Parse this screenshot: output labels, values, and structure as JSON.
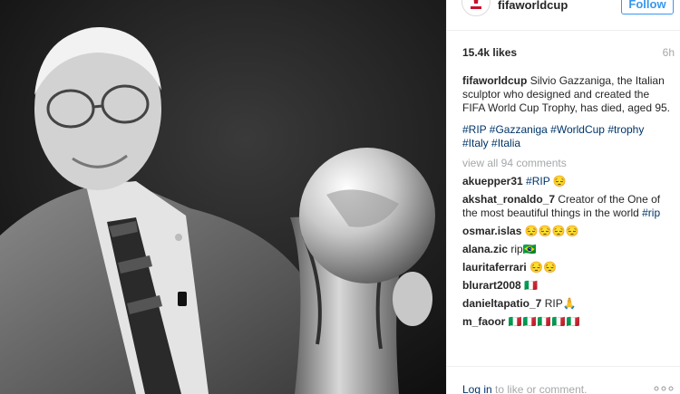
{
  "post": {
    "username": "fifaworldcup",
    "follow_label": "Follow",
    "likes": "15.4k likes",
    "time": "6h",
    "caption_text": "Silvio Gazzaniga, the Italian sculptor who designed and created the FIFA World Cup Trophy, has died, aged 95.",
    "hashtags": "#RIP #Gazzaniga #WorldCup #trophy #Italy #Italia",
    "view_all": "view all 94 comments",
    "photo_alt": "Silvio Gazzaniga holding the FIFA World Cup Trophy"
  },
  "comments": [
    {
      "user": "akuepper31",
      "text": "#RIP 😔"
    },
    {
      "user": "akshat_ronaldo_7",
      "text": "Creator of the One of the most beautiful things in the world #rip"
    },
    {
      "user": "osmar.islas",
      "text": "😔😔😔😔"
    },
    {
      "user": "alana.zic",
      "text": "rip🇧🇷"
    },
    {
      "user": "lauritaferrari",
      "text": "😔😔"
    },
    {
      "user": "blurart2008",
      "text": "🇮🇹"
    },
    {
      "user": "danieltapatio_7",
      "text": "RIP🙏"
    },
    {
      "user": "m_faoor",
      "text": "🇮🇹🇮🇹🇮🇹🇮🇹🇮🇹"
    }
  ],
  "footer": {
    "login_link": "Log in",
    "login_text": "to like or comment."
  },
  "icons": {
    "avatar": "fifa-world-cup-logo",
    "more": "more-options-icon"
  },
  "colors": {
    "link": "#003569",
    "follow": "#3897f0",
    "muted": "#a5a7aa"
  }
}
